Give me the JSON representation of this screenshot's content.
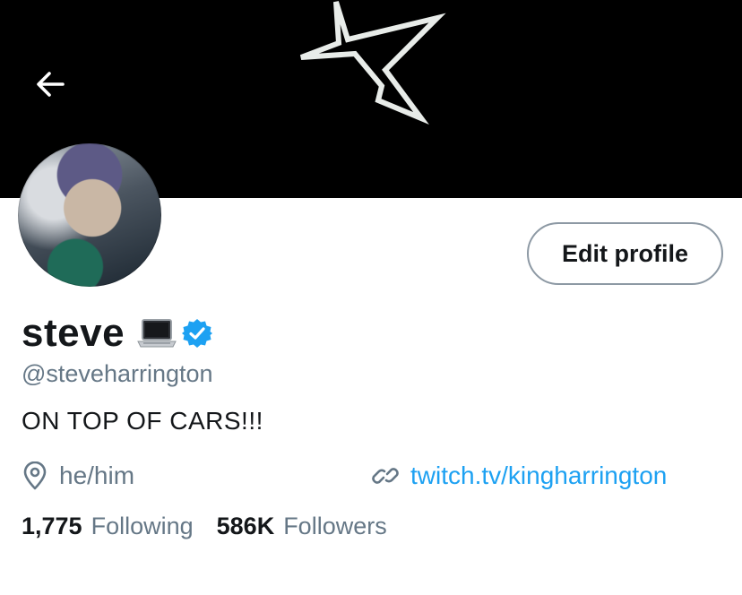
{
  "header": {
    "back_icon": "arrow-left-icon",
    "banner_icon": "star-outline-icon",
    "banner_color": "#000000"
  },
  "profile": {
    "avatar_icon": "profile-photo",
    "edit_button_label": "Edit profile",
    "display_name": "steve",
    "name_emoji": "laptop-emoji",
    "verified_icon": "verified-badge-icon",
    "handle": "@steveharrington",
    "bio": "ON TOP OF CARS!!!",
    "location_icon": "location-pin-icon",
    "location": "he/him",
    "link_icon": "link-icon",
    "website": "twitch.tv/kingharrington"
  },
  "stats": {
    "following_count": "1,775",
    "following_label": "Following",
    "followers_count": "586K",
    "followers_label": "Followers"
  },
  "colors": {
    "accent": "#1da1f2",
    "secondary_text": "#657786",
    "primary_text": "#14171a"
  }
}
